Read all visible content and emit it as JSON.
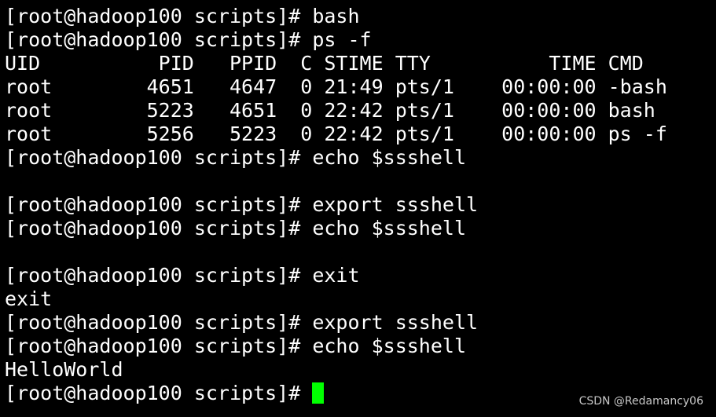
{
  "terminal": {
    "lines": [
      "[root@hadoop100 scripts]# bash",
      "[root@hadoop100 scripts]# ps -f",
      "UID          PID   PPID  C STIME TTY          TIME CMD",
      "root        4651   4647  0 21:49 pts/1    00:00:00 -bash",
      "root        5223   4651  0 22:42 pts/1    00:00:00 bash",
      "root        5256   5223  0 22:42 pts/1    00:00:00 ps -f",
      "[root@hadoop100 scripts]# echo $ssshell",
      "",
      "[root@hadoop100 scripts]# export ssshell",
      "[root@hadoop100 scripts]# echo $ssshell",
      "",
      "[root@hadoop100 scripts]# exit",
      "exit",
      "[root@hadoop100 scripts]# export ssshell",
      "[root@hadoop100 scripts]# echo $ssshell",
      "HelloWorld"
    ],
    "prompt": "[root@hadoop100 scripts]# ",
    "cursor_color": "#00ff00",
    "background_color": "#000000",
    "text_color": "#ffffff"
  },
  "watermark": {
    "text": "CSDN @Redamancy06"
  }
}
